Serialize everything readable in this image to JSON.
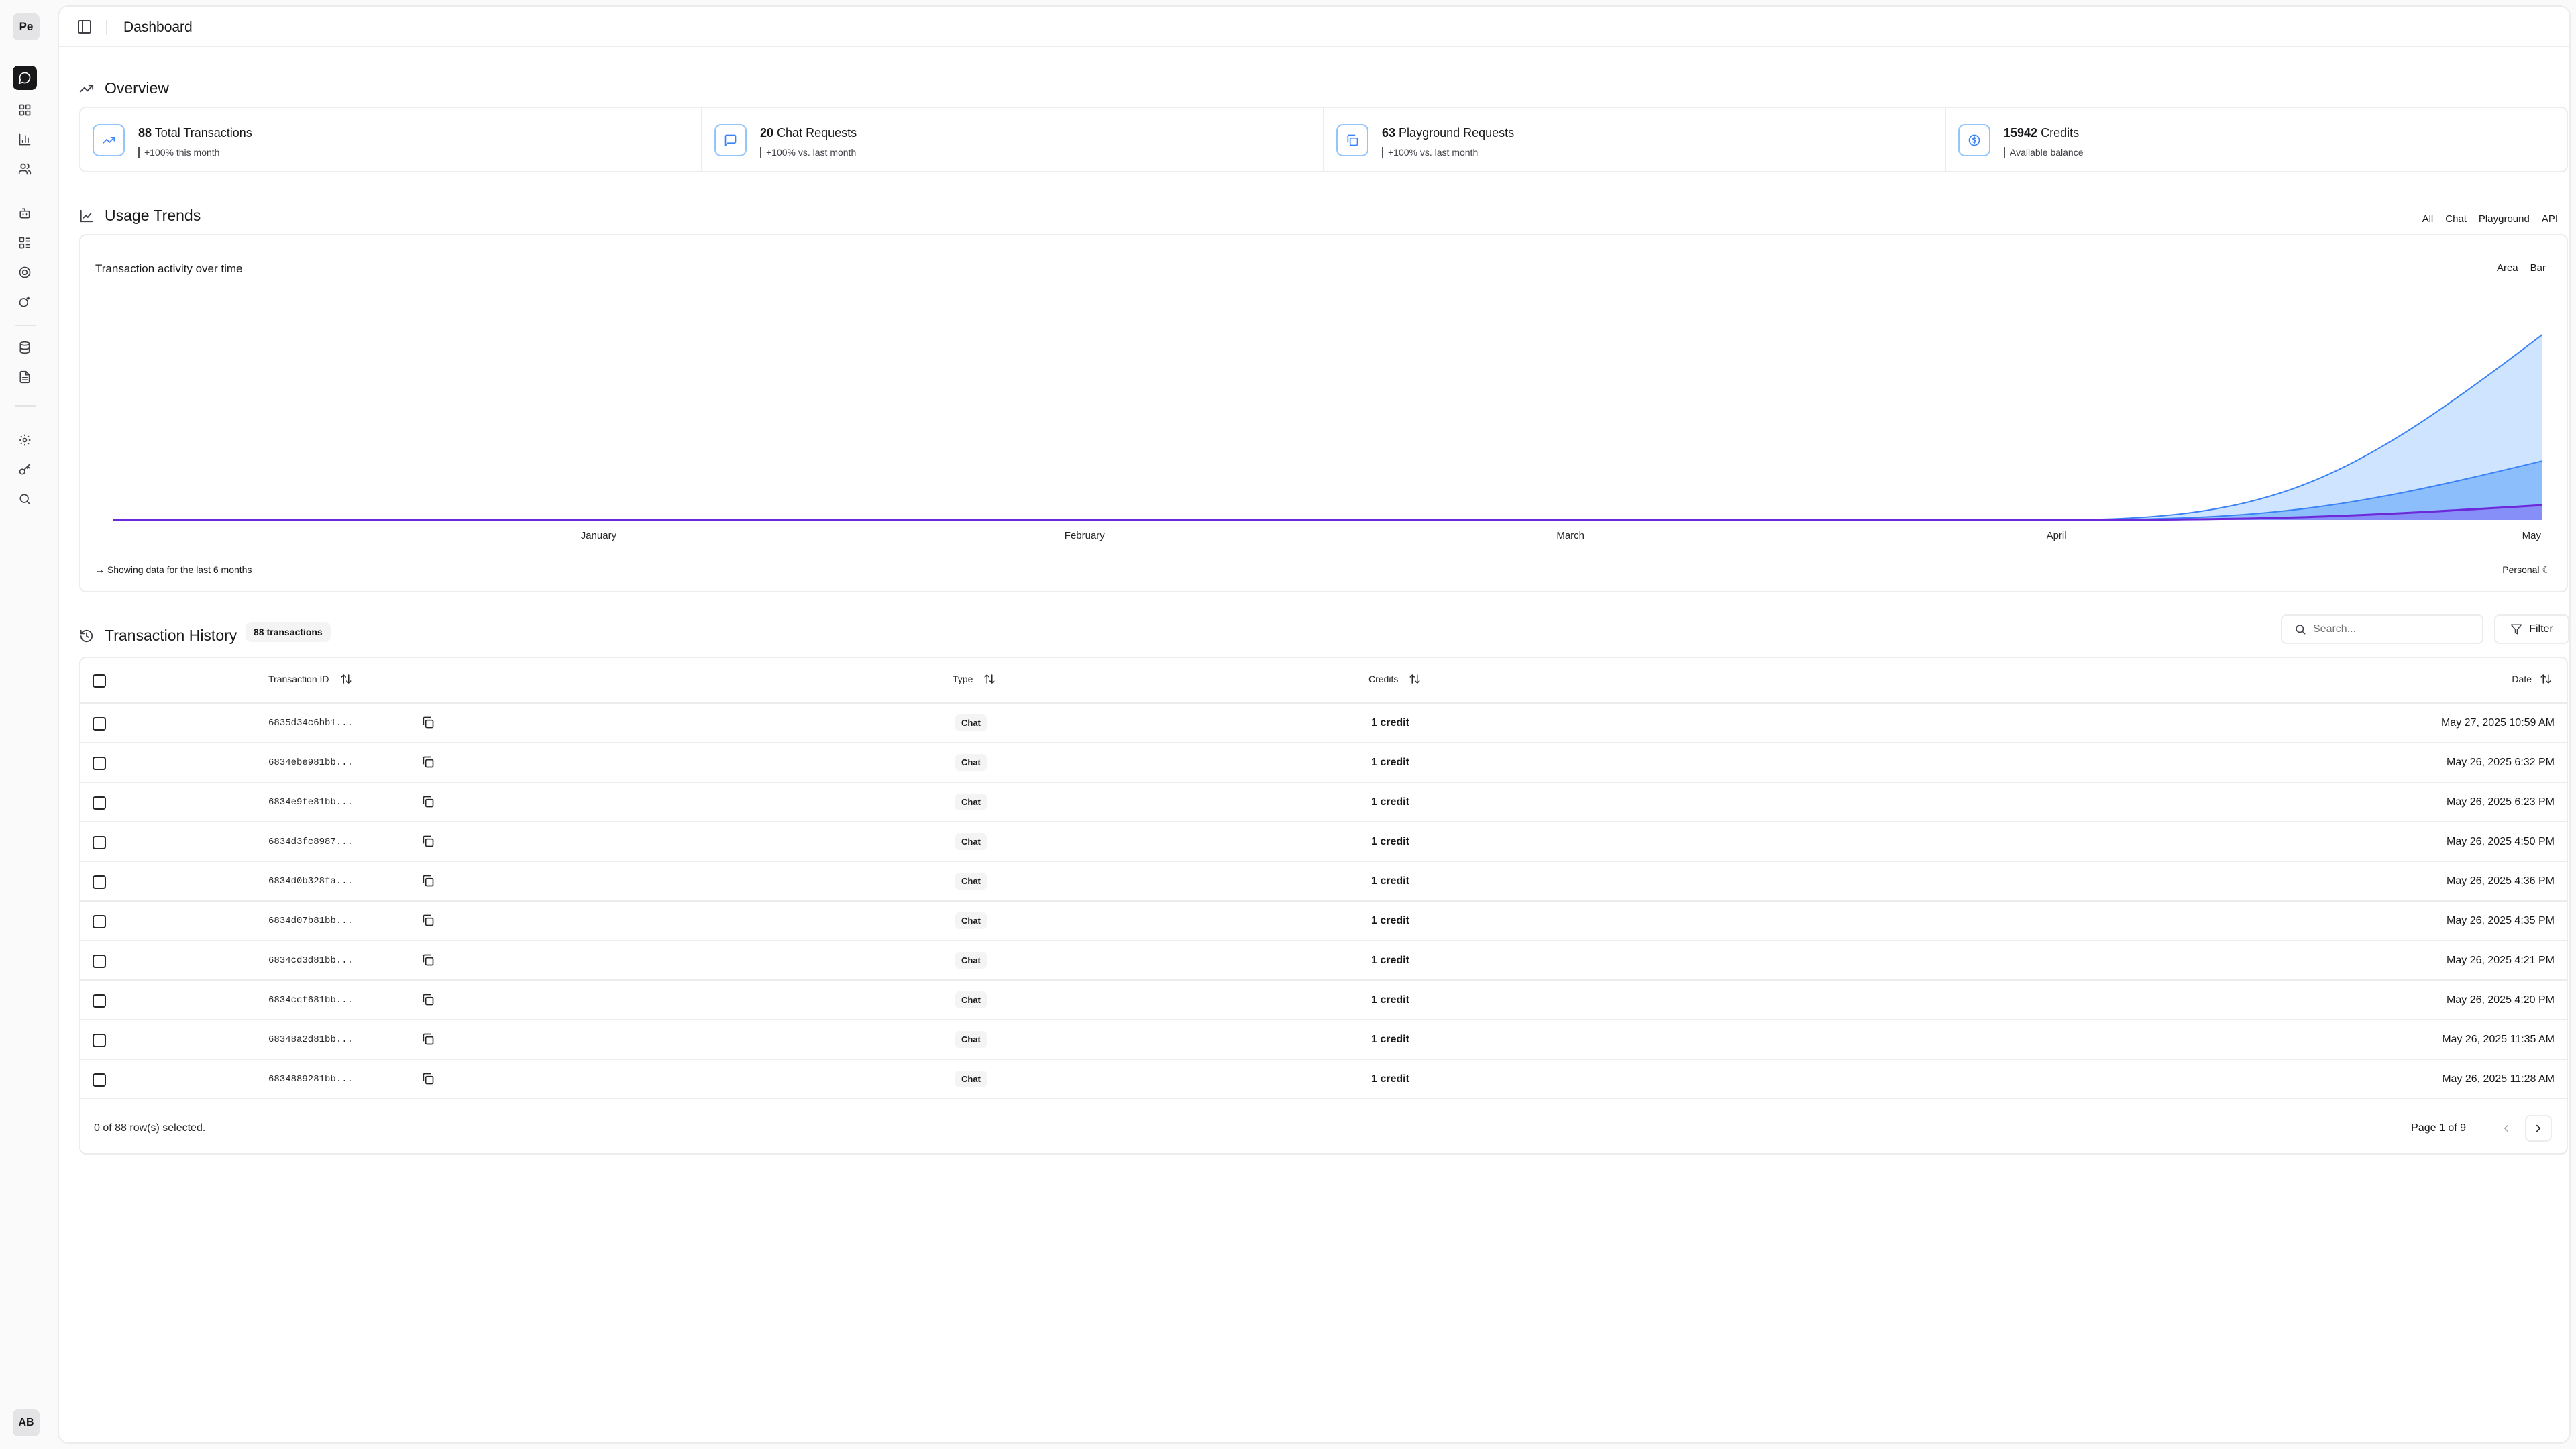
{
  "sidebar": {
    "logo": "Pe",
    "items": [
      {
        "name": "chat",
        "icon": "message-circle-icon"
      },
      {
        "name": "dashboard",
        "icon": "layout-grid-icon"
      },
      {
        "name": "analytics",
        "icon": "bar-chart-icon"
      },
      {
        "name": "users",
        "icon": "users-icon"
      },
      {
        "name": "bot",
        "icon": "bot-icon"
      },
      {
        "name": "apps",
        "icon": "apps-grid-icon"
      },
      {
        "name": "integrations",
        "icon": "target-icon"
      },
      {
        "name": "models",
        "icon": "sparkle-icon"
      },
      {
        "name": "database",
        "icon": "database-icon"
      },
      {
        "name": "documents",
        "icon": "file-text-icon"
      },
      {
        "name": "settings",
        "icon": "gear-icon"
      },
      {
        "name": "keys",
        "icon": "key-icon"
      },
      {
        "name": "search",
        "icon": "search-icon"
      }
    ],
    "user_initials": "AB"
  },
  "header": {
    "title": "Dashboard"
  },
  "overview": {
    "title": "Overview",
    "stats": [
      {
        "value": "88",
        "label": "Total Transactions",
        "sub": "+100% this month",
        "icon": "trending-up-icon"
      },
      {
        "value": "20",
        "label": "Chat Requests",
        "sub": "+100% vs. last month",
        "icon": "message-square-icon"
      },
      {
        "value": "63",
        "label": "Playground Requests",
        "sub": "+100% vs. last month",
        "icon": "copy-icon"
      },
      {
        "value": "15942",
        "label": "Credits",
        "sub": "Available balance",
        "icon": "coin-icon"
      }
    ]
  },
  "usage": {
    "title": "Usage Trends",
    "tabs": [
      "All",
      "Chat",
      "Playground",
      "API"
    ],
    "chart_title": "Transaction activity over time",
    "modes": [
      "Area",
      "Bar"
    ],
    "footer": "Showing data for the last 6 months",
    "footer_right": "Personal"
  },
  "chart_data": {
    "type": "area",
    "x": [
      "January",
      "February",
      "March",
      "April",
      "May"
    ],
    "series": [
      {
        "values": [
          0,
          0,
          0,
          0,
          88
        ],
        "color": "#bfdbfe"
      },
      {
        "values": [
          0,
          0,
          0,
          0,
          28
        ],
        "color": "#60a5fa"
      },
      {
        "values": [
          0,
          0,
          0,
          0,
          7
        ],
        "color": "#7c3aed"
      }
    ],
    "ylim": [
      0,
      100
    ],
    "grid": false,
    "legend": "none"
  },
  "transactions": {
    "title": "Transaction History",
    "count_label": "88 transactions",
    "search_placeholder": "Search...",
    "filter_label": "Filter",
    "columns": {
      "id": "Transaction ID",
      "type": "Type",
      "credits": "Credits",
      "date": "Date"
    },
    "rows": [
      {
        "id": "6835d34c6bb1...",
        "type": "Chat",
        "credits": "1 credit",
        "date": "May 27, 2025 10:59 AM"
      },
      {
        "id": "6834ebe981bb...",
        "type": "Chat",
        "credits": "1 credit",
        "date": "May 26, 2025 6:32 PM"
      },
      {
        "id": "6834e9fe81bb...",
        "type": "Chat",
        "credits": "1 credit",
        "date": "May 26, 2025 6:23 PM"
      },
      {
        "id": "6834d3fc8987...",
        "type": "Chat",
        "credits": "1 credit",
        "date": "May 26, 2025 4:50 PM"
      },
      {
        "id": "6834d0b328fa...",
        "type": "Chat",
        "credits": "1 credit",
        "date": "May 26, 2025 4:36 PM"
      },
      {
        "id": "6834d07b81bb...",
        "type": "Chat",
        "credits": "1 credit",
        "date": "May 26, 2025 4:35 PM"
      },
      {
        "id": "6834cd3d81bb...",
        "type": "Chat",
        "credits": "1 credit",
        "date": "May 26, 2025 4:21 PM"
      },
      {
        "id": "6834ccf681bb...",
        "type": "Chat",
        "credits": "1 credit",
        "date": "May 26, 2025 4:20 PM"
      },
      {
        "id": "68348a2d81bb...",
        "type": "Chat",
        "credits": "1 credit",
        "date": "May 26, 2025 11:35 AM"
      },
      {
        "id": "6834889281bb...",
        "type": "Chat",
        "credits": "1 credit",
        "date": "May 26, 2025 11:28 AM"
      }
    ],
    "selection_text": "0 of 88 row(s) selected.",
    "page_text": "Page 1 of 9"
  }
}
